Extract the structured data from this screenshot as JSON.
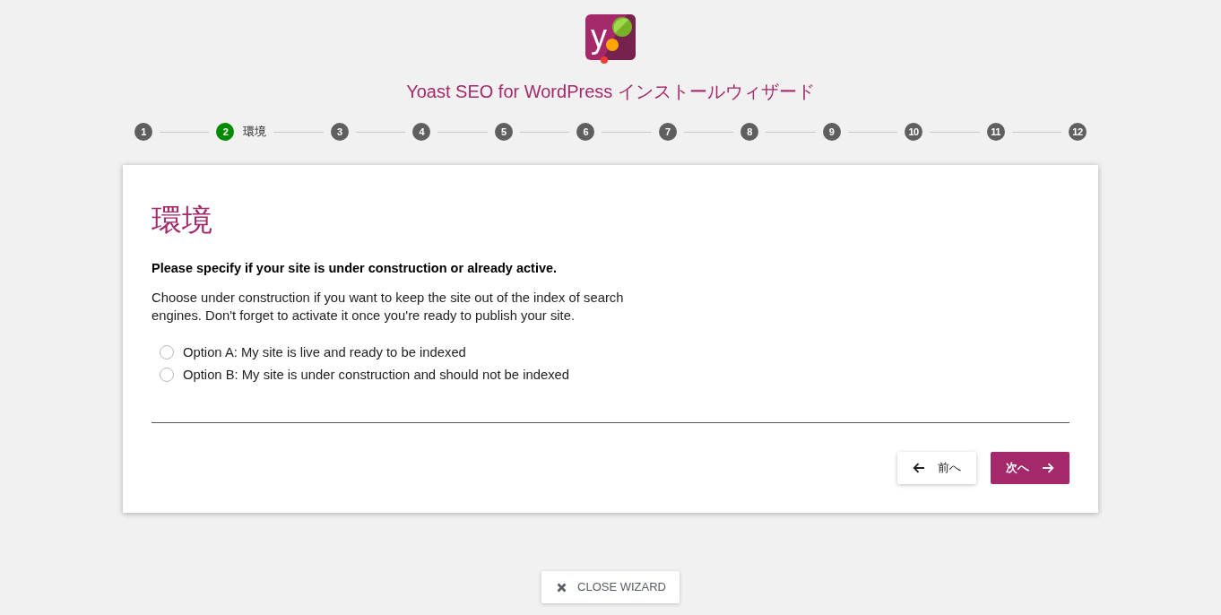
{
  "logo": {
    "text": "y"
  },
  "title": "Yoast SEO for WordPress インストールウィザード",
  "steps": [
    {
      "number": "1",
      "selected": false
    },
    {
      "number": "2",
      "label": "環境",
      "selected": true
    },
    {
      "number": "3",
      "selected": false
    },
    {
      "number": "4",
      "selected": false
    },
    {
      "number": "5",
      "selected": false
    },
    {
      "number": "6",
      "selected": false
    },
    {
      "number": "7",
      "selected": false
    },
    {
      "number": "8",
      "selected": false
    },
    {
      "number": "9",
      "selected": false
    },
    {
      "number": "10",
      "selected": false
    },
    {
      "number": "11",
      "selected": false
    },
    {
      "number": "12",
      "selected": false
    }
  ],
  "card": {
    "heading": "環境",
    "question": "Please specify if your site is under construction or already active.",
    "description": "Choose under construction if you want to keep the site out of the index of search engines. Don't forget to activate it once you're ready to publish your site.",
    "options": [
      {
        "label": "Option A: My site is live and ready to be indexed",
        "selected": false
      },
      {
        "label": "Option B: My site is under construction and should not be indexed",
        "selected": false
      }
    ],
    "buttons": [
      {
        "kind": "previous",
        "label": "前へ"
      },
      {
        "kind": "next",
        "label": "次へ"
      }
    ]
  },
  "close_button": {
    "label": "CLOSE WIZARD"
  }
}
